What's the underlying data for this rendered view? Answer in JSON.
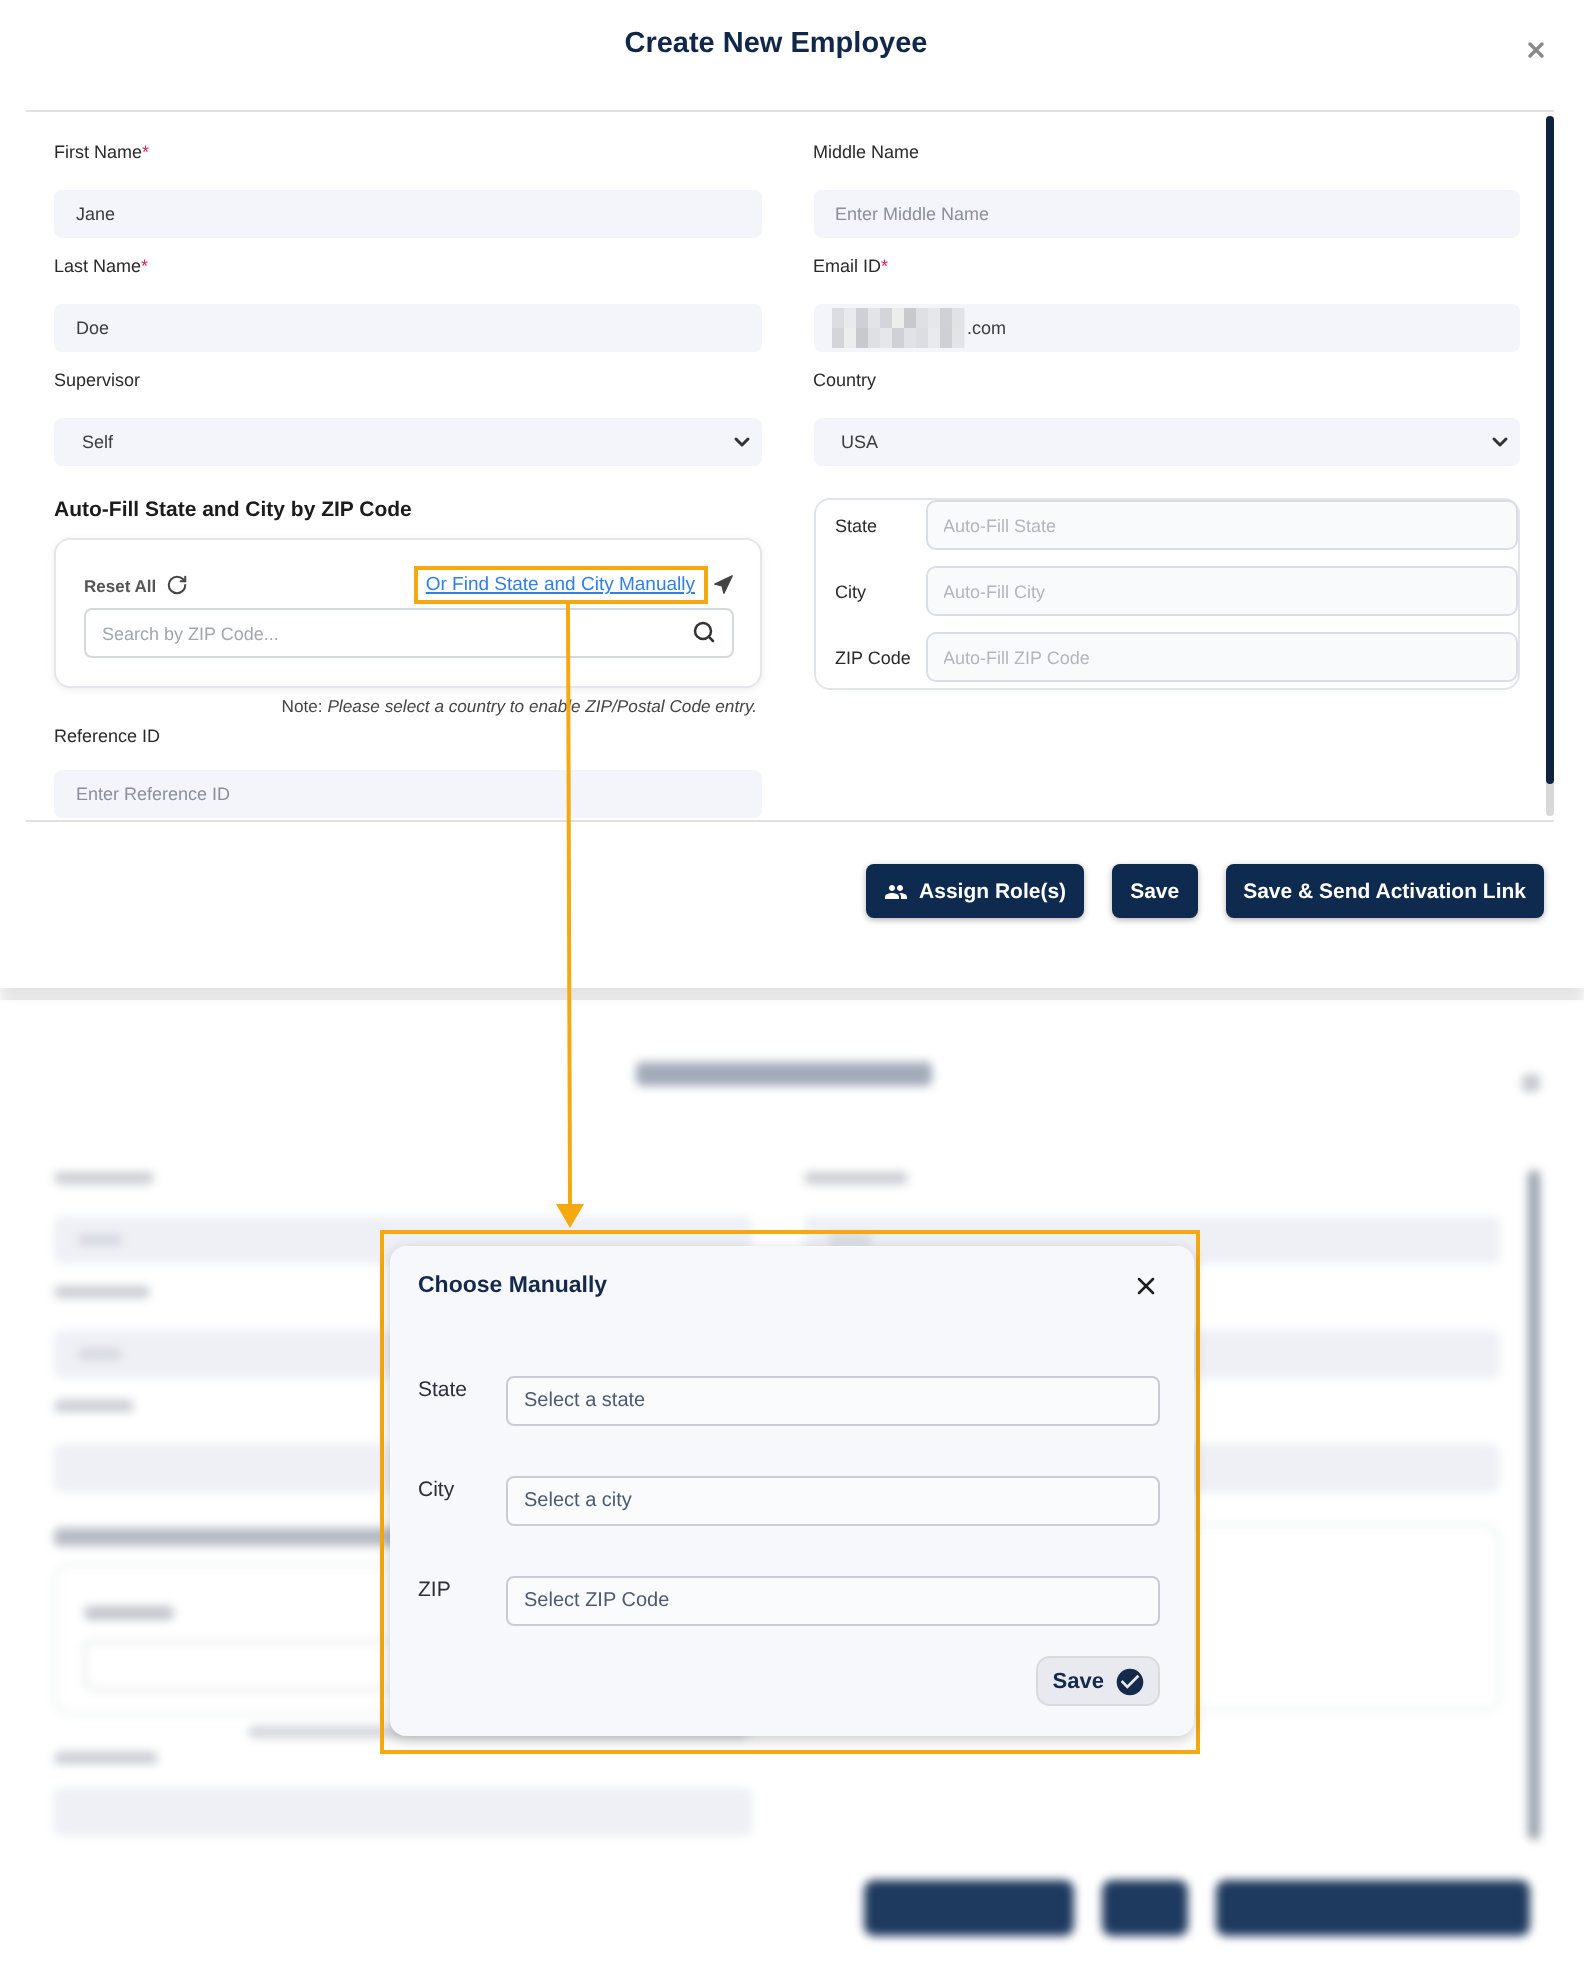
{
  "dialog": {
    "title": "Create New Employee"
  },
  "fields": [
    {
      "kind": "text",
      "label": "First Name",
      "required_mark": "*",
      "value": "Jane"
    },
    {
      "kind": "text",
      "label": "Middle Name",
      "placeholder": "Enter Middle Name"
    },
    {
      "kind": "text",
      "label": "Last Name",
      "required_mark": "*",
      "value": "Doe"
    },
    {
      "kind": "text",
      "label": "Email ID",
      "required_mark": "*",
      "value": ".com",
      "redacted": true
    },
    {
      "kind": "select",
      "label": "Supervisor",
      "value": "Self"
    },
    {
      "kind": "select",
      "label": "Country",
      "value": "USA"
    }
  ],
  "zip_lookup": {
    "heading": "Auto-Fill State and City by ZIP Code",
    "reset_label": "Reset All",
    "manual_link": "Or Find State and City Manually",
    "search_placeholder": "Search by ZIP Code...",
    "note": "Note: *Please select a country to enable ZIP/Postal Code entry.*"
  },
  "reference_field": {
    "label": "Reference ID",
    "placeholder": "Enter Reference ID"
  },
  "address_fields": [
    {
      "label": "State",
      "placeholder": "Auto-Fill State"
    },
    {
      "label": "City",
      "placeholder": "Auto-Fill City"
    },
    {
      "label": "ZIP Code",
      "placeholder": "Auto-Fill ZIP Code"
    }
  ],
  "footer_buttons": [
    {
      "kind": "icon",
      "label": "Assign Role(s)"
    },
    {
      "kind": "plain",
      "label": "Save"
    },
    {
      "kind": "plain",
      "label": "Save & Send Activation Link"
    }
  ],
  "manual_popup": {
    "title": "Choose Manually",
    "fields": [
      {
        "label": "State",
        "placeholder": "Select a state"
      },
      {
        "label": "City",
        "placeholder": "Select a city"
      },
      {
        "label": "ZIP",
        "placeholder": "Select ZIP Code"
      }
    ],
    "save_label": "Save"
  }
}
